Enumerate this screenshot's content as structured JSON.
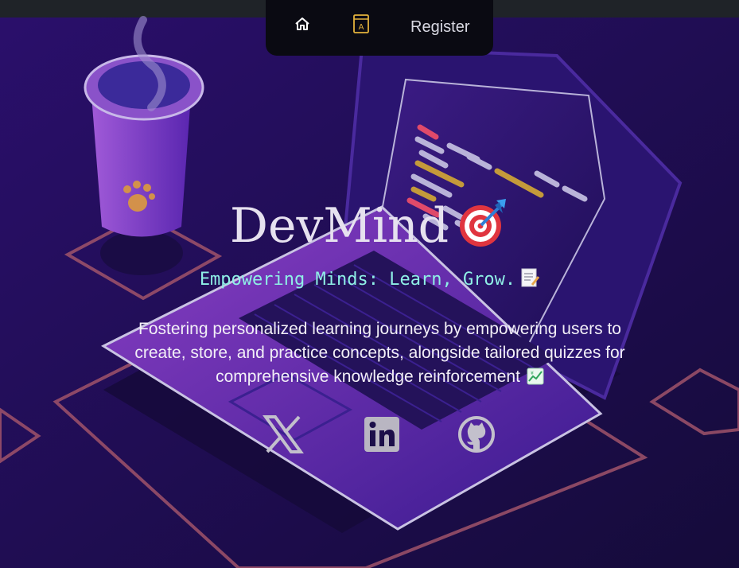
{
  "nav": {
    "home_icon": "home-icon",
    "book_icon": "book-icon",
    "register_label": "Register"
  },
  "hero": {
    "title": "DevMind",
    "title_emoji": "dart-target-emoji",
    "tagline": "Empowering Minds: Learn, Grow.",
    "tagline_emoji": "memo-emoji",
    "description": "Fostering personalized learning journeys by empowering users to create, store, and practice concepts, alongside tailored quizzes for comprehensive knowledge reinforcement",
    "description_emoji": "chart-yen-emoji"
  },
  "social": [
    {
      "icon": "x-twitter-icon"
    },
    {
      "icon": "linkedin-icon"
    },
    {
      "icon": "github-icon"
    }
  ],
  "colors": {
    "background": "#1c0f4a",
    "title": "#e6e1ef",
    "tagline": "#8ff0e6",
    "accent_gold": "#e3b23c",
    "navbar": "#0a0a12"
  }
}
